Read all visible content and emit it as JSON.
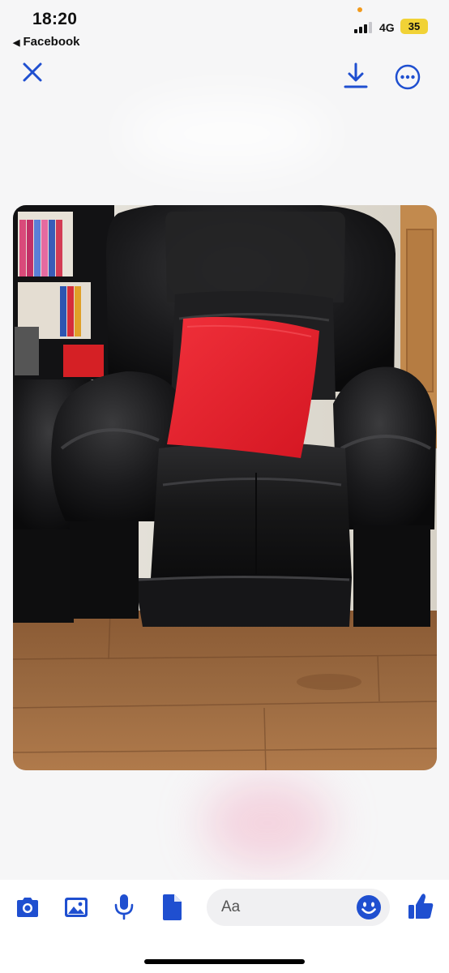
{
  "status_bar": {
    "time": "18:20",
    "back_app_label": "Facebook",
    "network": "4G",
    "battery_level": "35"
  },
  "toolbar": {
    "close_icon": "close-icon",
    "download_icon": "download-icon",
    "more_icon": "more-options-icon"
  },
  "photo": {
    "subject": "black leather recliner armchair with red cushion on wooden floor"
  },
  "composer": {
    "placeholder": "Aa",
    "icons": [
      "camera-icon",
      "gallery-icon",
      "microphone-icon",
      "document-icon",
      "emoji-icon",
      "like-icon"
    ]
  },
  "colors": {
    "accent": "#1f4fd0",
    "background": "#f6f6f7",
    "battery": "#f1d236",
    "cushion": "#e2202a"
  }
}
